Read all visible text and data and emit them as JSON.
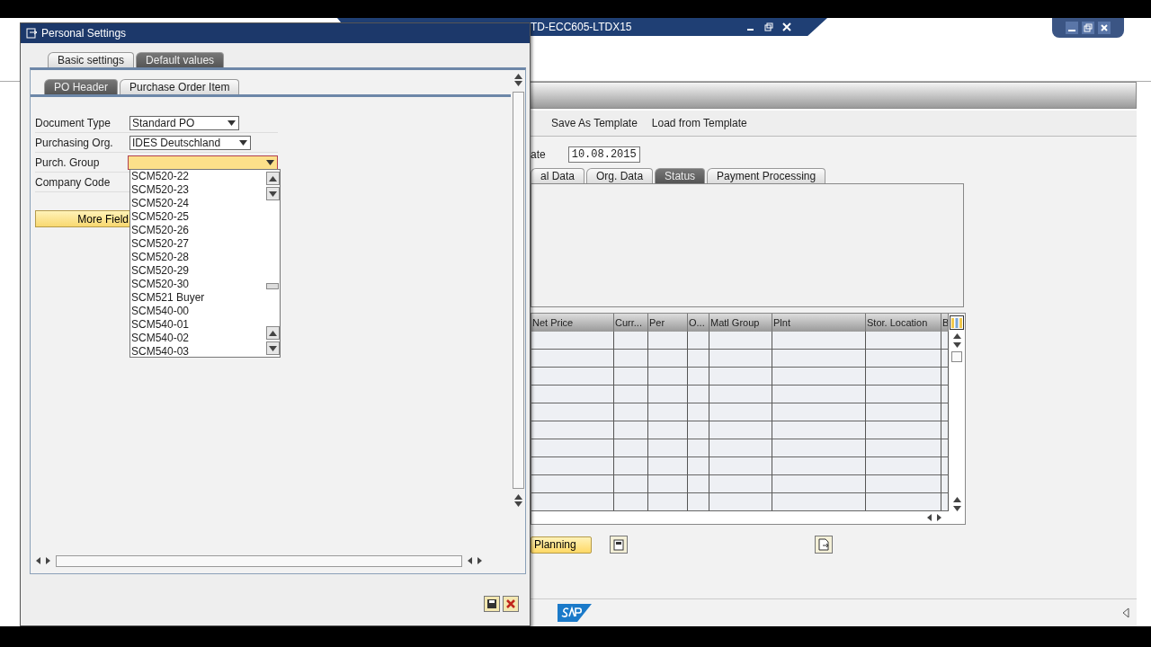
{
  "window": {
    "title": "TD-ECC605-LTDX15"
  },
  "toolbar": {
    "buttons": [
      "Save As Template",
      "Load from Template"
    ]
  },
  "header": {
    "date_label": "ate",
    "date": "10.08.2015"
  },
  "tabs": [
    {
      "label": "al Data",
      "selected": false
    },
    {
      "label": "Org. Data",
      "selected": false
    },
    {
      "label": "Status",
      "selected": true
    },
    {
      "label": "Payment Processing",
      "selected": false
    }
  ],
  "item_table": {
    "columns": [
      "Net Price",
      "Curr...",
      "Per",
      "O...",
      "Matl Group",
      "Plnt",
      "Stor. Location",
      "B"
    ]
  },
  "actions": {
    "planning": "Planning"
  },
  "dialog": {
    "title": "Personal Settings",
    "tabs": [
      {
        "label": "Basic settings",
        "selected": false
      },
      {
        "label": "Default values",
        "selected": true
      }
    ],
    "subtabs": [
      {
        "label": "PO Header",
        "selected": true
      },
      {
        "label": "Purchase Order Item",
        "selected": false
      }
    ],
    "fields": [
      {
        "label": "Document Type",
        "value": "Standard PO"
      },
      {
        "label": "Purchasing Org.",
        "value": "IDES Deutschland"
      },
      {
        "label": "Purch. Group",
        "focused": true
      },
      {
        "label": "Company Code"
      }
    ],
    "more_button": "More Field",
    "dropdown": {
      "items": [
        "SCM520-22",
        "SCM520-23",
        "SCM520-24",
        "SCM520-25",
        "SCM520-26",
        "SCM520-27",
        "SCM520-28",
        "SCM520-29",
        "SCM520-30",
        "SCM521 Buyer",
        "SCM540-00",
        "SCM540-01",
        "SCM540-02",
        "SCM540-03"
      ]
    }
  }
}
